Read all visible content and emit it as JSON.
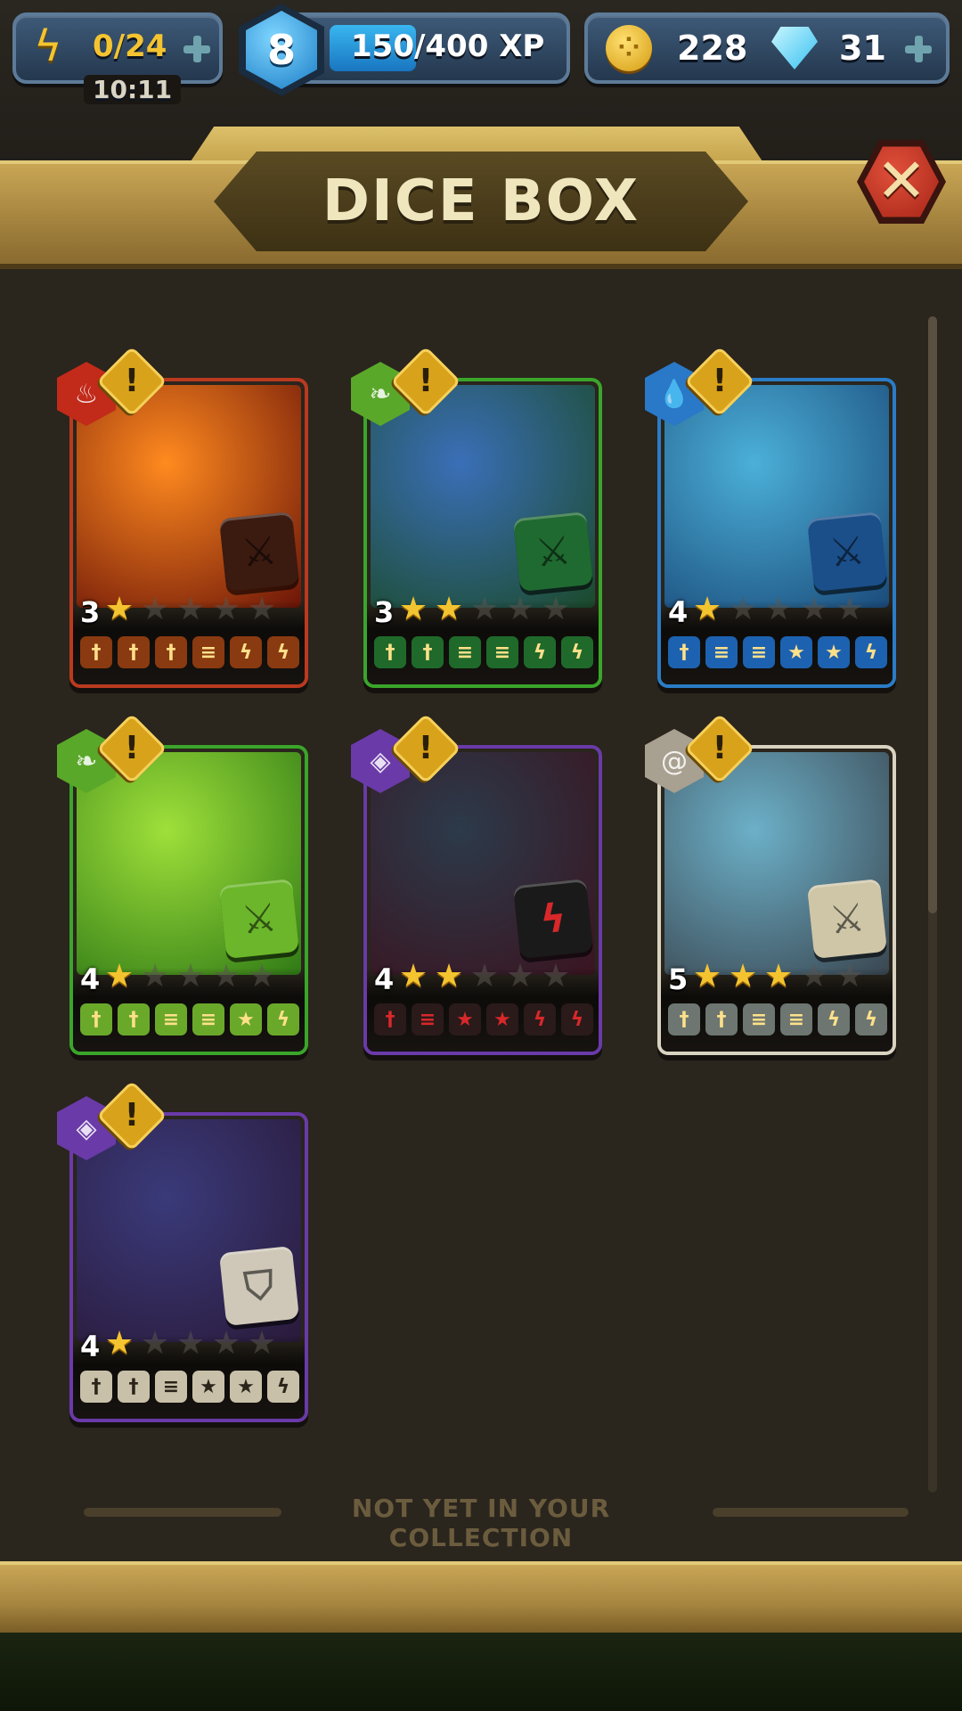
{
  "hud": {
    "energy": "0/24",
    "energy_timer": "10:11",
    "player_level": "8",
    "xp": "150/400 XP",
    "xp_progress": 0.375,
    "coins": "228",
    "gems": "31"
  },
  "header": {
    "title": "DICE BOX"
  },
  "cards": [
    {
      "level": "3",
      "stars_filled": 1,
      "element": "fire",
      "frame": "#b93a1f",
      "art_from": "#ff8a1f",
      "art_to": "#6b1408",
      "die_color": "#3b1a10",
      "die_glyph": "⚔",
      "faces": [
        {
          "icon": "sword",
          "bg": "#8a3a10"
        },
        {
          "icon": "sword",
          "bg": "#8a3a10"
        },
        {
          "icon": "sword",
          "bg": "#8a3a10"
        },
        {
          "icon": "shield",
          "bg": "#8a3a10"
        },
        {
          "icon": "bolt",
          "bg": "#8a3a10"
        },
        {
          "icon": "bolt",
          "bg": "#8a3a10"
        }
      ]
    },
    {
      "level": "3",
      "stars_filled": 2,
      "element": "nature",
      "frame": "#3aa52a",
      "art_from": "#3a6fb8",
      "art_to": "#1b4a2a",
      "die_color": "#1f6a30",
      "die_glyph": "⚔",
      "faces": [
        {
          "icon": "sword",
          "bg": "#1f6a2a"
        },
        {
          "icon": "sword",
          "bg": "#1f6a2a"
        },
        {
          "icon": "shield",
          "bg": "#1f6a2a"
        },
        {
          "icon": "shield",
          "bg": "#1f6a2a"
        },
        {
          "icon": "bolt",
          "bg": "#1f6a2a"
        },
        {
          "icon": "bolt",
          "bg": "#1f6a2a"
        }
      ]
    },
    {
      "level": "4",
      "stars_filled": 1,
      "element": "water",
      "frame": "#2a7cc6",
      "art_from": "#4bb0d8",
      "art_to": "#1a4a7a",
      "die_color": "#1b4f8a",
      "die_glyph": "⚔",
      "faces": [
        {
          "icon": "sword",
          "bg": "#1d62b0"
        },
        {
          "icon": "shield",
          "bg": "#1d62b0"
        },
        {
          "icon": "shield",
          "bg": "#1d62b0"
        },
        {
          "icon": "star",
          "bg": "#1d62b0"
        },
        {
          "icon": "star",
          "bg": "#1d62b0"
        },
        {
          "icon": "bolt",
          "bg": "#1d62b0"
        }
      ]
    },
    {
      "level": "4",
      "stars_filled": 1,
      "element": "nature",
      "frame": "#3aa52a",
      "art_from": "#9fe03a",
      "art_to": "#2f7a16",
      "die_color": "#6bb62a",
      "die_glyph": "⚔",
      "faces": [
        {
          "icon": "sword",
          "bg": "#6aa82a"
        },
        {
          "icon": "sword",
          "bg": "#6aa82a"
        },
        {
          "icon": "shield",
          "bg": "#6aa82a"
        },
        {
          "icon": "shield",
          "bg": "#6aa82a"
        },
        {
          "icon": "star",
          "bg": "#6aa82a"
        },
        {
          "icon": "bolt",
          "bg": "#6aa82a"
        }
      ]
    },
    {
      "level": "4",
      "stars_filled": 2,
      "element": "dark",
      "frame": "#6a3aa8",
      "art_from": "#2c3a4a",
      "art_to": "#3a1420",
      "die_color": "#1a1a1a",
      "die_glyph": "ϟ",
      "faces": [
        {
          "icon": "sword",
          "bg": "#2a1a1a"
        },
        {
          "icon": "shield",
          "bg": "#2a1a1a"
        },
        {
          "icon": "star",
          "bg": "#2a1a1a"
        },
        {
          "icon": "star",
          "bg": "#2a1a1a"
        },
        {
          "icon": "bolt",
          "bg": "#2a1a1a"
        },
        {
          "icon": "bolt",
          "bg": "#2a1a1a"
        }
      ]
    },
    {
      "level": "5",
      "stars_filled": 3,
      "element": "air",
      "frame": "#d8d2c0",
      "art_from": "#6cb0c8",
      "art_to": "#3a4650",
      "die_color": "#cfc6a8",
      "die_glyph": "⚔",
      "faces": [
        {
          "icon": "sword",
          "bg": "#6d7670"
        },
        {
          "icon": "sword",
          "bg": "#6d7670"
        },
        {
          "icon": "shield",
          "bg": "#6d7670"
        },
        {
          "icon": "shield",
          "bg": "#6d7670"
        },
        {
          "icon": "bolt",
          "bg": "#6d7670"
        },
        {
          "icon": "bolt",
          "bg": "#6d7670"
        }
      ]
    },
    {
      "level": "4",
      "stars_filled": 1,
      "element": "dark",
      "frame": "#6a3aa8",
      "art_from": "#3a3a7a",
      "art_to": "#2a1a3a",
      "die_color": "#cfc8b8",
      "die_glyph": "⛉",
      "faces": [
        {
          "icon": "sword",
          "bg": "#c8c0a8"
        },
        {
          "icon": "sword",
          "bg": "#c8c0a8"
        },
        {
          "icon": "shield",
          "bg": "#c8c0a8"
        },
        {
          "icon": "star",
          "bg": "#c8c0a8"
        },
        {
          "icon": "star",
          "bg": "#c8c0a8"
        },
        {
          "icon": "bolt",
          "bg": "#c8c0a8"
        }
      ]
    }
  ],
  "divider": {
    "label": "NOT YET IN YOUR COLLECTION"
  },
  "icons": {
    "element_glyphs": {
      "fire": "♨",
      "nature": "❧",
      "water": "💧",
      "dark": "◈",
      "air": "@"
    },
    "face_glyphs": {
      "sword": "†",
      "shield": "≡",
      "star": "★",
      "bolt": "ϟ"
    }
  }
}
